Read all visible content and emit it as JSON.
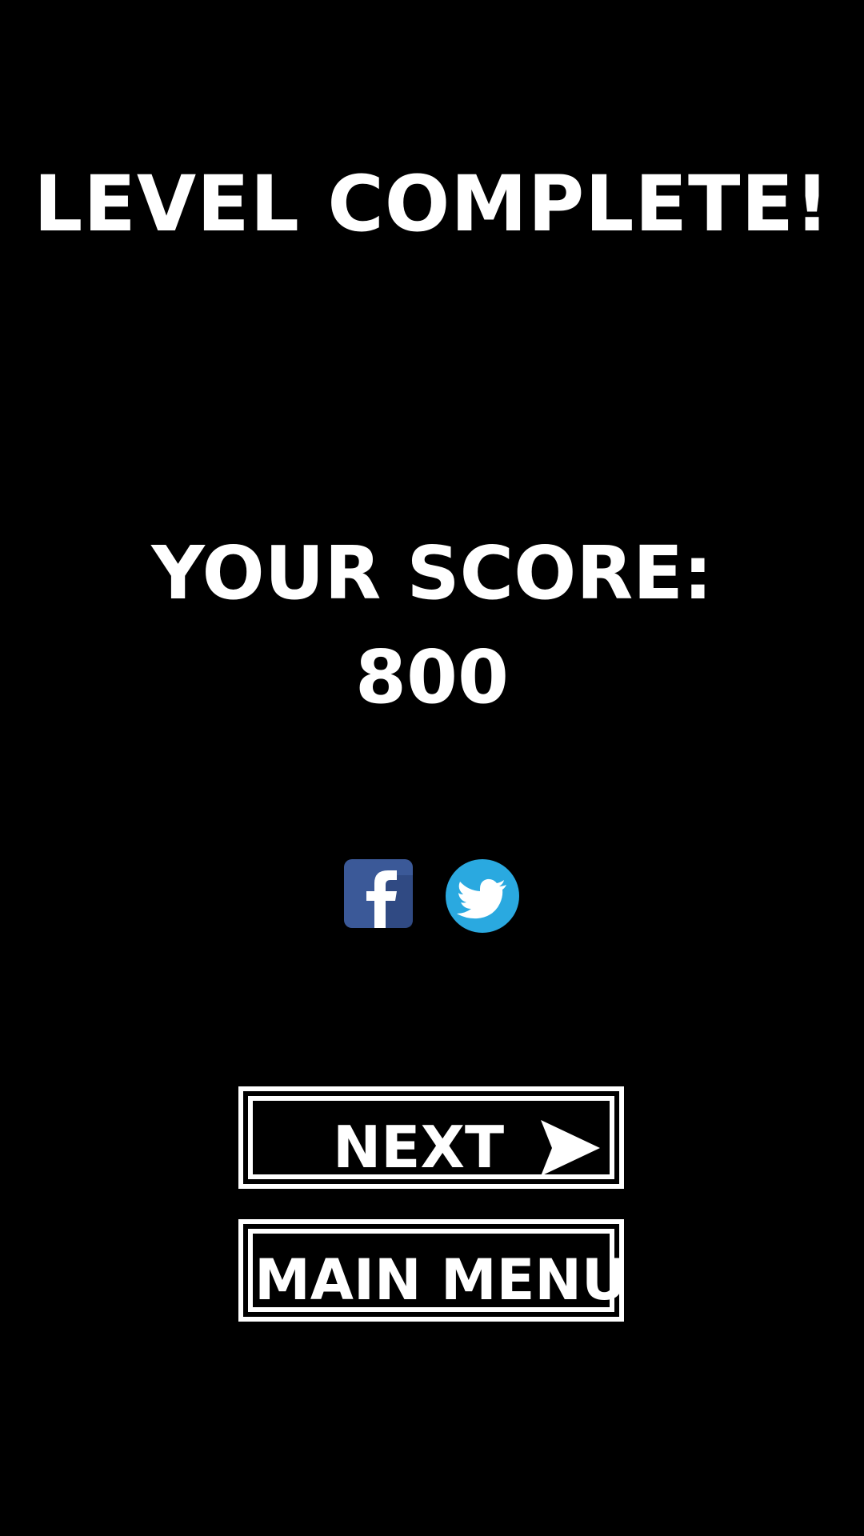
{
  "screen": {
    "title": "LEVEL COMPLETE!",
    "score_label": "YOUR SCORE:",
    "score_value": "800"
  },
  "social": {
    "facebook_icon": "facebook-icon",
    "twitter_icon": "twitter-icon"
  },
  "buttons": {
    "next_label": "NEXT",
    "next_icon": "arrow-right-icon",
    "main_menu_label": "MAIN MENU"
  },
  "colors": {
    "background": "#000000",
    "foreground": "#ffffff",
    "facebook": "#3b5998",
    "twitter": "#2aa9e0"
  }
}
